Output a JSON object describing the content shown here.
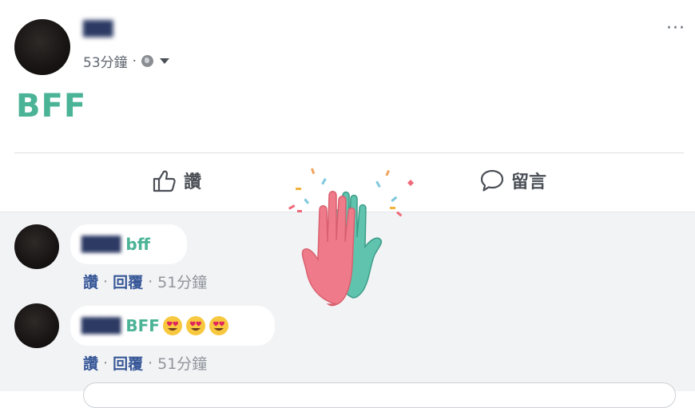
{
  "post": {
    "author_name": "███",
    "time": "53分鐘",
    "separator": "·",
    "text": "BFF",
    "more_label": "···"
  },
  "actions": {
    "like_label": "讚",
    "comment_label": "留言"
  },
  "comments": [
    {
      "author": "████",
      "text": "bff",
      "emojis": [],
      "like_label": "讚",
      "reply_label": "回覆",
      "separator": "·",
      "time": "51分鐘"
    },
    {
      "author": "████",
      "text": "BFF",
      "emojis": [
        "heart-eyes-emoji",
        "heart-eyes-emoji",
        "heart-eyes-emoji"
      ],
      "like_label": "讚",
      "reply_label": "回覆",
      "separator": "·",
      "time": "51分鐘"
    }
  ],
  "colors": {
    "post_text": "#4bb396",
    "comment_bg": "#f2f3f5",
    "link": "#385898",
    "hand_pink": "#ef7b8a",
    "hand_teal": "#5fc3ad"
  },
  "icons": {
    "like": "thumbs-up-icon",
    "comment": "speech-bubble-icon",
    "privacy": "globe-icon",
    "audience": "caret-down-icon",
    "reaction": "high-five-reaction"
  }
}
